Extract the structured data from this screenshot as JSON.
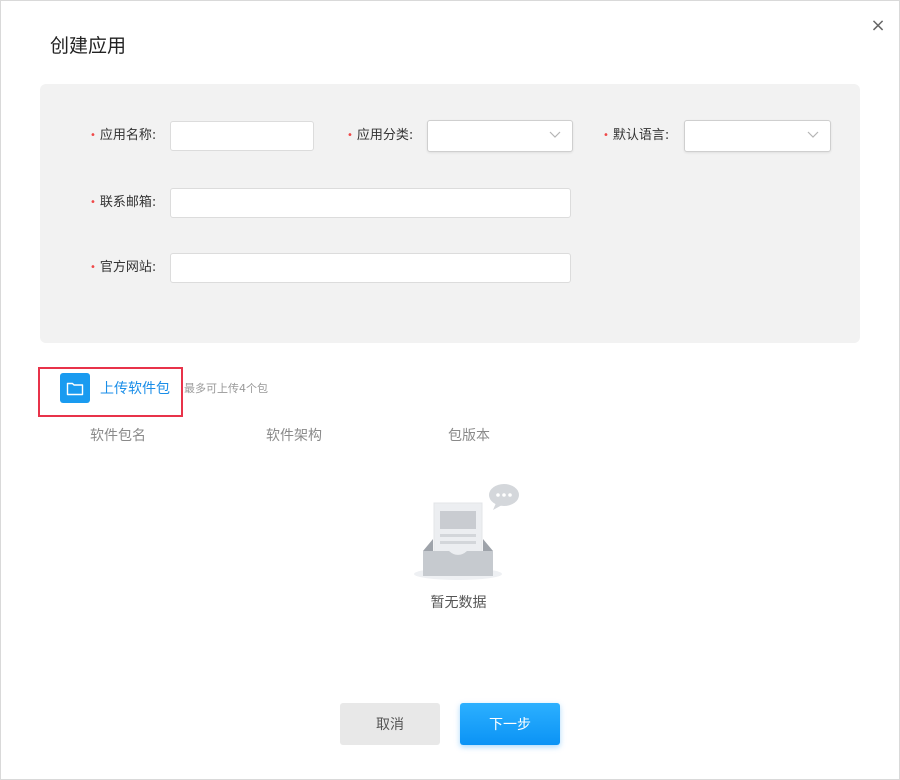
{
  "dialog": {
    "title": "创建应用",
    "close_label": "×"
  },
  "form": {
    "app_name": {
      "label": "应用名称:",
      "value": "",
      "placeholder": ""
    },
    "app_category": {
      "label": "应用分类:",
      "value": ""
    },
    "default_language": {
      "label": "默认语言:",
      "value": ""
    },
    "email": {
      "label": "联系邮箱:",
      "value": "",
      "placeholder": ""
    },
    "website": {
      "label": "官方网站:",
      "value": "",
      "placeholder": ""
    },
    "required_mark": "•"
  },
  "upload": {
    "button_label": "上传软件包",
    "hint": "最多可上传4个包",
    "icon": "folder-icon"
  },
  "table": {
    "columns": [
      "软件包名",
      "软件架构",
      "包版本"
    ],
    "empty_text": "暂无数据"
  },
  "footer": {
    "cancel_label": "取消",
    "next_label": "下一步"
  },
  "colors": {
    "accent": "#1a9bf0",
    "required": "#f04848",
    "highlight": "#e8334a"
  }
}
